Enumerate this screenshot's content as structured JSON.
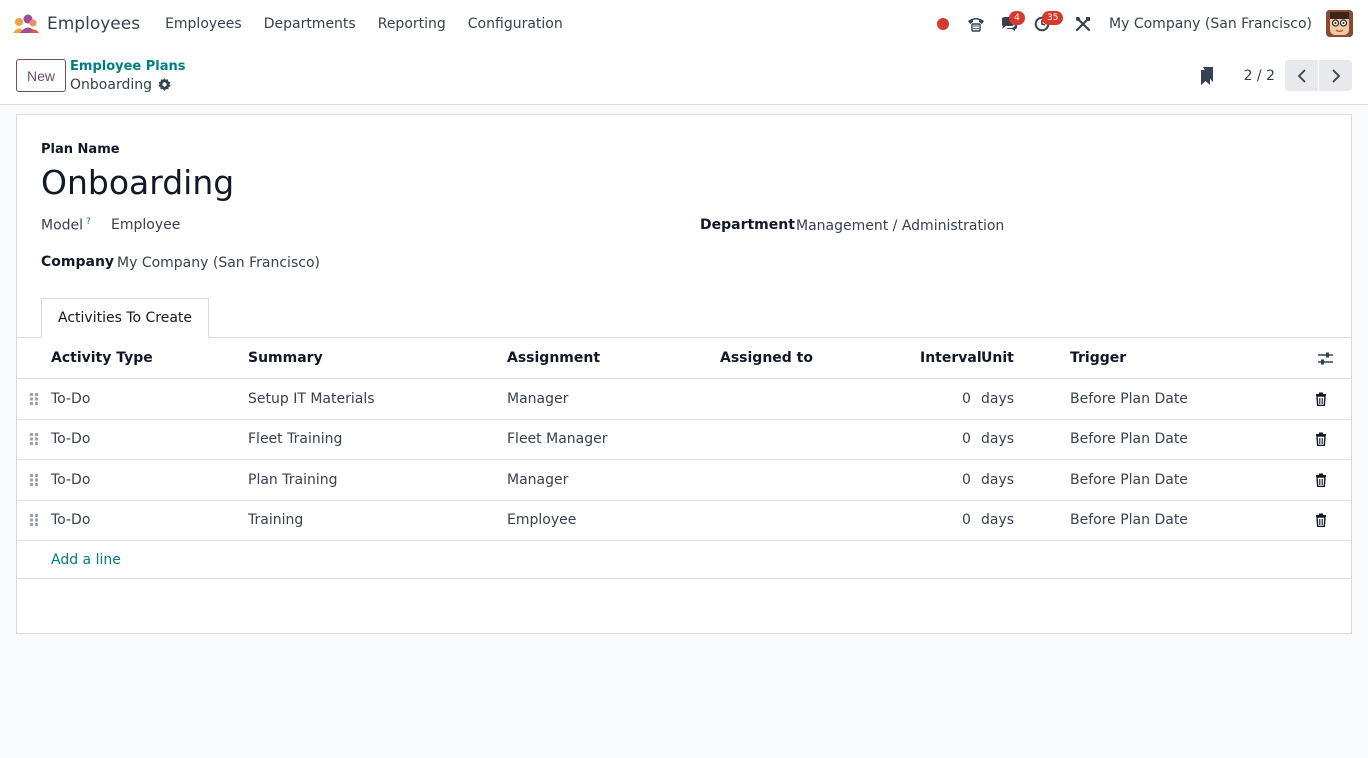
{
  "navbar": {
    "app_name": "Employees",
    "menu": [
      "Employees",
      "Departments",
      "Reporting",
      "Configuration"
    ],
    "messages_count": "4",
    "activities_count": "35",
    "company": "My Company (San Francisco)"
  },
  "control_panel": {
    "new_label": "New",
    "breadcrumb_parent": "Employee Plans",
    "breadcrumb_current": "Onboarding",
    "pager": "2 / 2"
  },
  "form": {
    "plan_name_label": "Plan Name",
    "plan_name": "Onboarding",
    "model_label": "Model",
    "model_help": "?",
    "model_value": "Employee",
    "department_label": "Department",
    "department_value": "Management / Administration",
    "company_label": "Company",
    "company_value": "My Company (San Francisco)"
  },
  "tabs": {
    "activities": "Activities To Create"
  },
  "table": {
    "columns": {
      "activity_type": "Activity Type",
      "summary": "Summary",
      "assignment": "Assignment",
      "assigned_to": "Assigned to",
      "interval": "Interval",
      "unit": "Unit",
      "trigger": "Trigger"
    },
    "rows": [
      {
        "activity_type": "To-Do",
        "summary": "Setup IT Materials",
        "assignment": "Manager",
        "assigned_to": "",
        "interval": "0",
        "unit": "days",
        "trigger": "Before Plan Date"
      },
      {
        "activity_type": "To-Do",
        "summary": "Fleet Training",
        "assignment": "Fleet Manager",
        "assigned_to": "",
        "interval": "0",
        "unit": "days",
        "trigger": "Before Plan Date"
      },
      {
        "activity_type": "To-Do",
        "summary": "Plan Training",
        "assignment": "Manager",
        "assigned_to": "",
        "interval": "0",
        "unit": "days",
        "trigger": "Before Plan Date"
      },
      {
        "activity_type": "To-Do",
        "summary": "Training",
        "assignment": "Employee",
        "assigned_to": "",
        "interval": "0",
        "unit": "days",
        "trigger": "Before Plan Date"
      }
    ],
    "add_line": "Add a line"
  },
  "colors": {
    "brand": "#714b67",
    "link": "#017e84",
    "badge": "#d9392c"
  }
}
